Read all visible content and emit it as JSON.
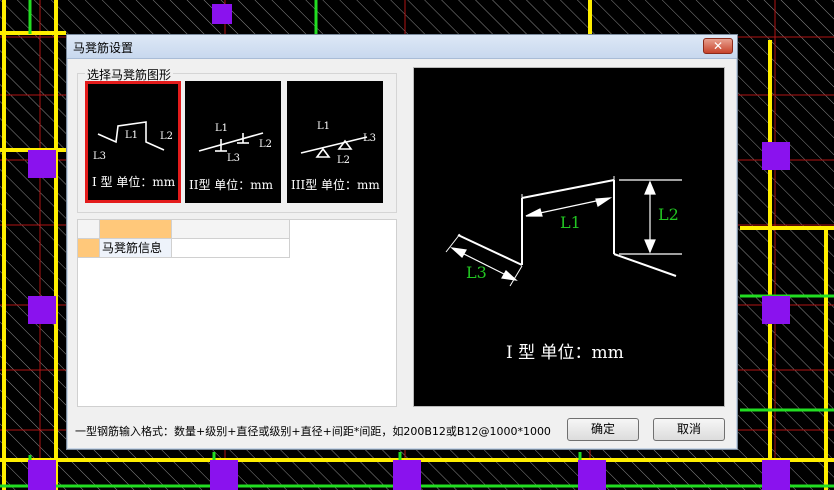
{
  "window": {
    "title": "马凳筋设置",
    "close_icon": "close-icon"
  },
  "shape_group": {
    "label": "选择马凳筋图形",
    "options": [
      {
        "caption": "I 型 单位：mm",
        "selected": true,
        "labels": {
          "L1": "L1",
          "L2": "L2",
          "L3": "L3"
        }
      },
      {
        "caption": "II型 单位：mm",
        "selected": false,
        "labels": {
          "L1": "L1",
          "L2": "L2",
          "L3": "L3"
        }
      },
      {
        "caption": "III型 单位：mm",
        "selected": false,
        "labels": {
          "L1": "L1",
          "L2": "L2",
          "L3": "L3"
        }
      }
    ]
  },
  "property_grid": {
    "header": [
      "",
      "",
      ""
    ],
    "rows": [
      {
        "name": "马凳筋信息",
        "value": ""
      }
    ]
  },
  "preview": {
    "caption": "I 型 单位：mm",
    "labels": {
      "L1": "L1",
      "L2": "L2",
      "L3": "L3"
    }
  },
  "hint": "一型钢筋输入格式：数量+级别+直径或级别+直径+间距*间距，如200B12或B12@1000*1000",
  "buttons": {
    "ok": "确定",
    "cancel": "取消"
  },
  "colors": {
    "selected_border": "#e31b1b",
    "dimension_label": "#22c522",
    "grid_header": "#ffc87a"
  }
}
